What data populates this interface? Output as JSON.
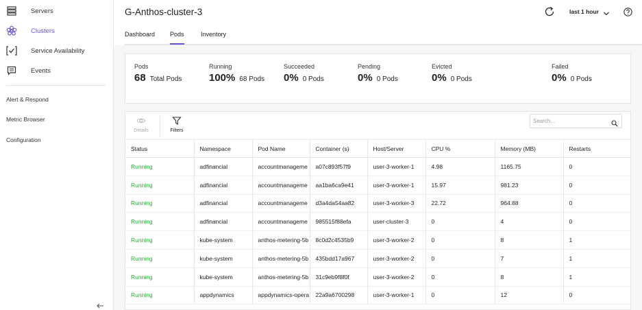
{
  "sidebar": {
    "items": [
      {
        "label": "Servers",
        "icon": "servers-icon"
      },
      {
        "label": "Clusters",
        "icon": "clusters-icon",
        "active": true
      },
      {
        "label": "Service Availability",
        "icon": "service-availability-icon"
      },
      {
        "label": "Events",
        "icon": "events-icon"
      }
    ],
    "links": [
      "Alert & Respond",
      "Metric Browser",
      "Configuration"
    ],
    "collapse_icon": "arrow-left-icon"
  },
  "header": {
    "title": "G-Anthos-cluster-3",
    "time_range": "last 1 hour",
    "refresh_icon": "refresh-icon",
    "help_icon": "help-icon"
  },
  "tabs": [
    {
      "label": "Dashboard"
    },
    {
      "label": "Pods",
      "active": true
    },
    {
      "label": "Inventory"
    }
  ],
  "summary": {
    "pods": {
      "label": "Pods",
      "value": "68",
      "unit": "Total Pods"
    },
    "running": {
      "label": "Running",
      "value": "100%",
      "unit": "68 Pods"
    },
    "succeeded": {
      "label": "Succeeded",
      "value": "0%",
      "unit": "0 Pods"
    },
    "pending": {
      "label": "Pending",
      "value": "0%",
      "unit": "0 Pods"
    },
    "evicted": {
      "label": "Evicted",
      "value": "0%",
      "unit": "0 Pods"
    },
    "failed": {
      "label": "Failed",
      "value": "0%",
      "unit": "0 Pods"
    }
  },
  "toolbar": {
    "details_label": "Details",
    "filters_label": "Filters",
    "search_placeholder": "Search..."
  },
  "table": {
    "columns": [
      "Status",
      "Namespace",
      "Pod Name",
      "Container (s)",
      "Host/Server",
      "CPU %",
      "Memory (MB)",
      "Restarts"
    ],
    "rows": [
      [
        "Running",
        "adfinancial",
        "accountmanageme",
        "a07c893f57f9",
        "user-3-worker-1",
        "4.98",
        "1165.75",
        "0"
      ],
      [
        "Running",
        "adfinancial",
        "accountmanageme",
        "aa1ba6ca9e41",
        "user-3-worker-1",
        "15.97",
        "981.23",
        "0"
      ],
      [
        "Running",
        "adfinancial",
        "accountmanageme",
        "d3a4da54aa82",
        "user-3-worker-3",
        "22.72",
        "964.88",
        "0"
      ],
      [
        "Running",
        "adfinancial",
        "accountmanageme",
        "985515f88efa",
        "user-cluster-3",
        "0",
        "4",
        "0"
      ],
      [
        "Running",
        "kube-system",
        "anthos-metering-5b",
        "8c0d2c4535b9",
        "user-3-worker-2",
        "0",
        "8",
        "1"
      ],
      [
        "Running",
        "kube-system",
        "anthos-metering-5b",
        "435bdd17a967",
        "user-3-worker-2",
        "0",
        "7",
        "1"
      ],
      [
        "Running",
        "kube-system",
        "anthos-metering-5b",
        "31c9eb9f8f0f",
        "user-3-worker-2",
        "0",
        "8",
        "1"
      ],
      [
        "Running",
        "appdynamics",
        "appdynamics-opera",
        "22a9a6700298",
        "user-3-worker-1",
        "0",
        "12",
        "0"
      ]
    ]
  },
  "colors": {
    "accent": "#6f55d8",
    "status_running": "#26a936"
  }
}
